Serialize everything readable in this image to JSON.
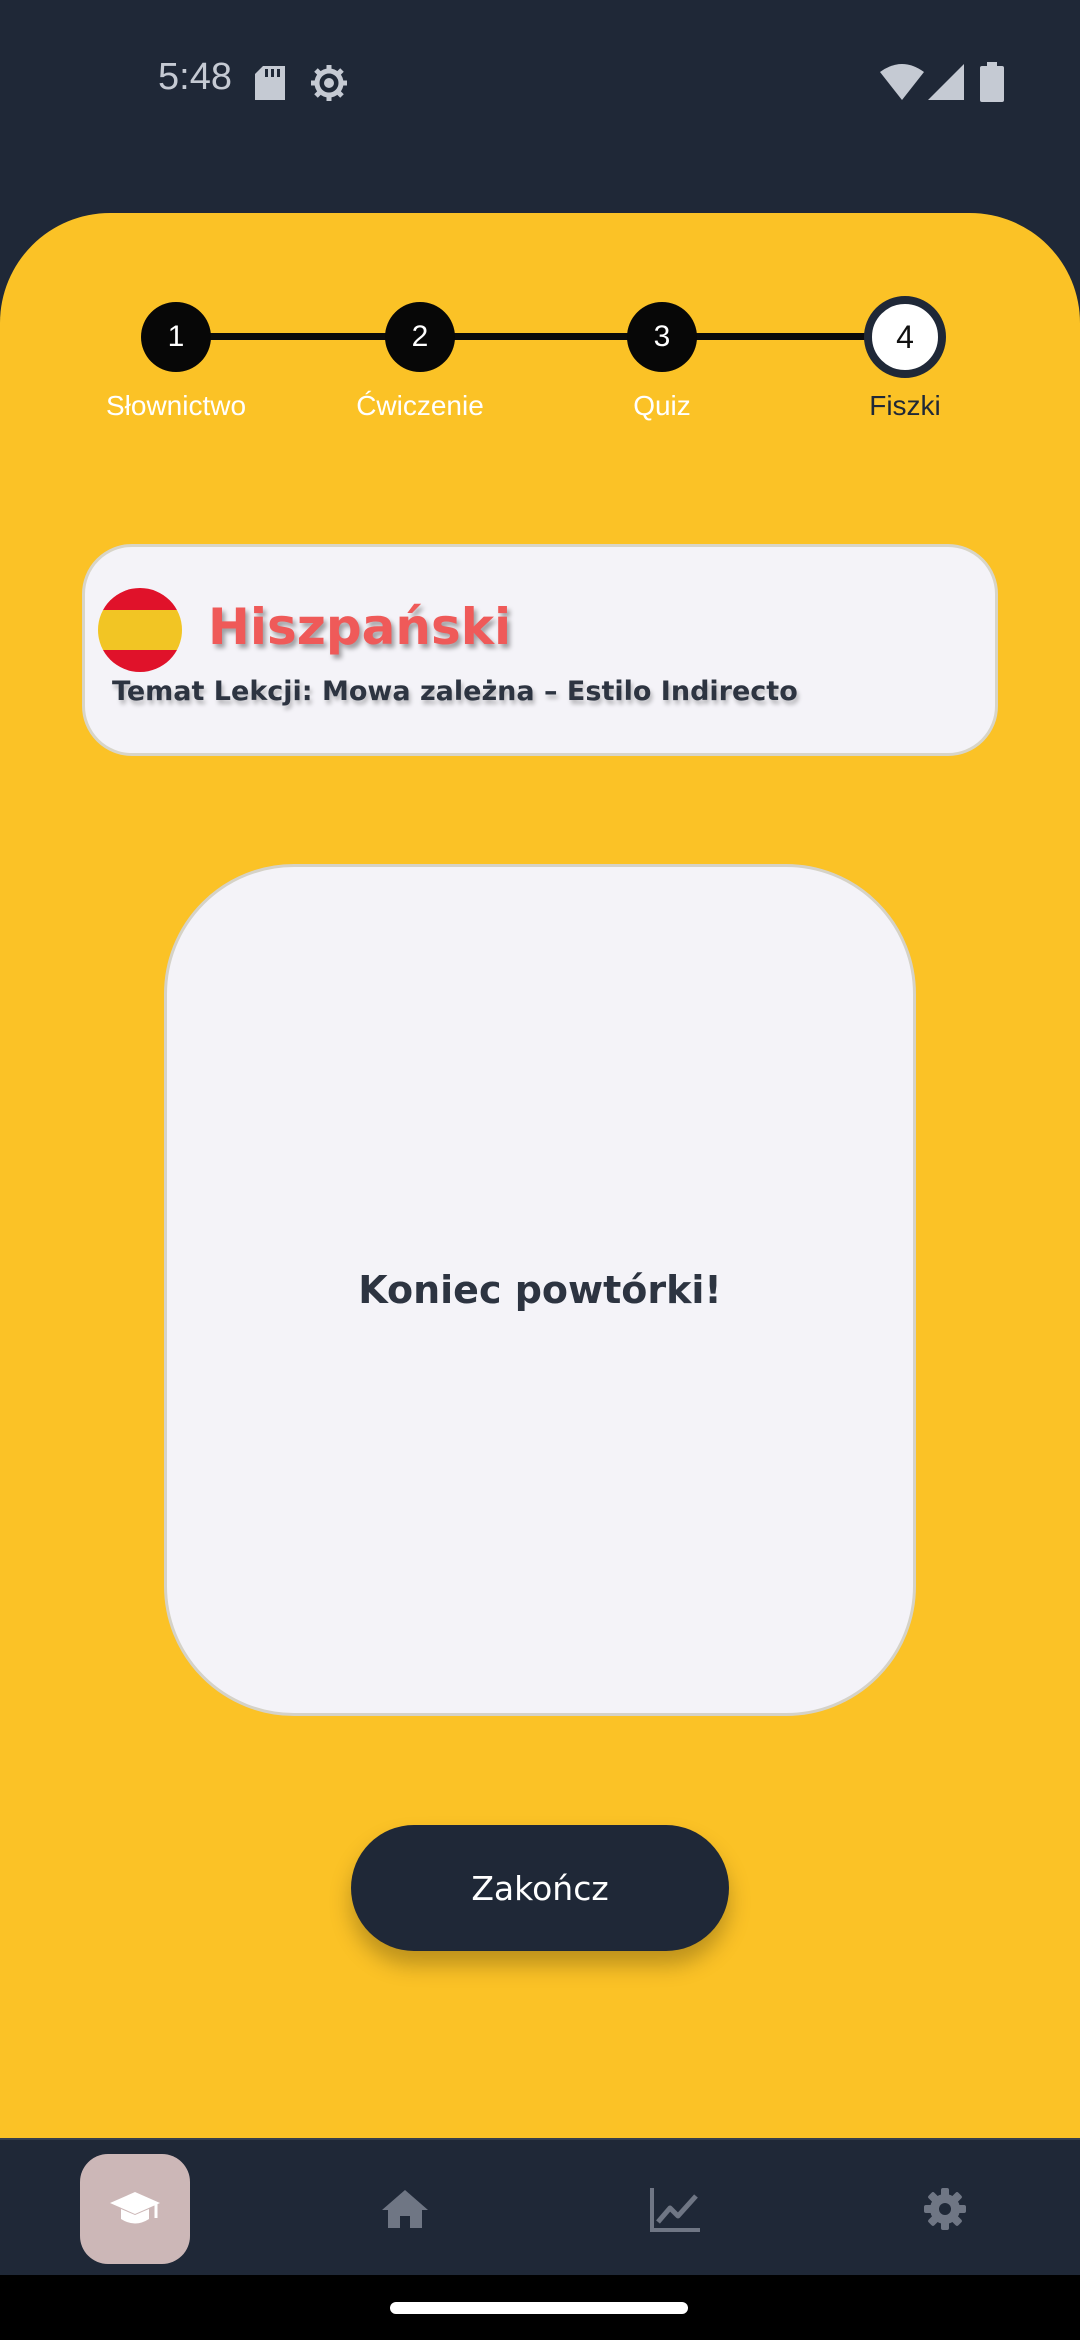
{
  "status_bar": {
    "time": "5:48"
  },
  "stepper": {
    "steps": [
      {
        "number": "1",
        "label": "Słownictwo"
      },
      {
        "number": "2",
        "label": "Ćwiczenie"
      },
      {
        "number": "3",
        "label": "Quiz"
      },
      {
        "number": "4",
        "label": "Fiszki"
      }
    ],
    "active_step": 4
  },
  "lesson": {
    "language": "Hiszpański",
    "topic": "Temat Lekcji: Mowa zależna – Estilo Indirecto",
    "flag_icon": "spain-flag-icon"
  },
  "flashcard": {
    "text": "Koniec powtórki!"
  },
  "actions": {
    "finish_label": "Zakończ"
  },
  "bottom_nav": {
    "items": [
      {
        "icon": "graduation-cap-icon",
        "active": true
      },
      {
        "icon": "home-icon",
        "active": false
      },
      {
        "icon": "chart-icon",
        "active": false
      },
      {
        "icon": "gear-icon",
        "active": false
      }
    ]
  },
  "colors": {
    "background": "#fbc226",
    "dark": "#1f2837",
    "card": "#f4f3f8",
    "accent": "#ef5a59",
    "nav_active": "#ccb7b7"
  }
}
